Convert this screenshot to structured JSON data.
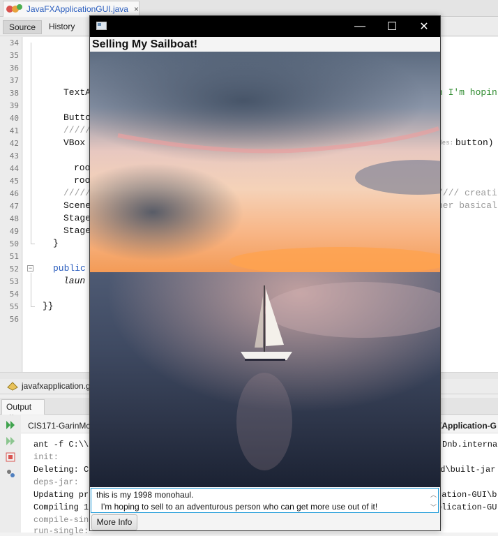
{
  "ide": {
    "file_tab": {
      "label": "JavaFXApplicationGUI.java",
      "close": "×"
    },
    "toolbar": {
      "source": "Source",
      "history": "History"
    },
    "line_numbers": [
      "34",
      "35",
      "36",
      "37",
      "38",
      "39",
      "40",
      "41",
      "42",
      "43",
      "44",
      "45",
      "46",
      "47",
      "48",
      "49",
      "50",
      "51",
      "52",
      "53",
      "54",
      "55",
      "56"
    ],
    "code_visible": {
      "l38": "TextA",
      "l38r": "n I'm hopin",
      "l40": "Butto",
      "l41": "/////",
      "l42": "VBox",
      "l42r_hint": "odes:",
      "l42r": "button)",
      "l44": "root.",
      "l45": "root.",
      "l46": "/////",
      "l46r": "//// creati",
      "l47": "Scene",
      "l47r": "her basical",
      "l48": "Stage",
      "l49": "Stage",
      "l50": "}",
      "l52": "public",
      "l53": "laun",
      "l55": "}}"
    },
    "navigator_tab": {
      "label": "javafxapplication.g"
    },
    "output_tab": {
      "label": "Output",
      "close": "×"
    },
    "run_head": {
      "left": "CIS171-GarinMc",
      "right": "XApplication-G"
    },
    "output_lines": [
      {
        "left": "ant -f C:\\\\",
        "right": "Dnb.internal"
      },
      {
        "left": "init:",
        "right": ""
      },
      {
        "left": "Deleting: C",
        "right": "ld\\built-jar"
      },
      {
        "left": "deps-jar:",
        "right": ""
      },
      {
        "left": "Updating pr",
        "right": "cation-GUI\\b"
      },
      {
        "left": "Compiling 1",
        "right": "plication-GU"
      },
      {
        "left": "compile-sin",
        "right": ""
      },
      {
        "left": "run-single:",
        "right": ""
      }
    ]
  },
  "app_window": {
    "controls": {
      "minimize": "—",
      "maximize": "☐",
      "close": "✕"
    },
    "heading": "Selling My Sailboat!",
    "description": {
      "line1": "this is my 1998 monohaul.",
      "line2": "  I'm hoping to sell to an adventurous person who can get more use out of it!"
    },
    "more_info_button": "More Info"
  },
  "colors": {
    "accent_focus": "#1b9ad8",
    "title_bar": "#000000",
    "ide_link": "#2a5dbe"
  }
}
